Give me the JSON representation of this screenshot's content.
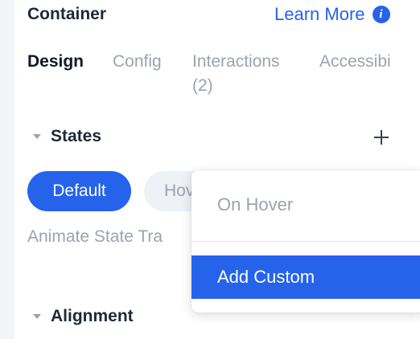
{
  "header": {
    "title": "Container",
    "learn_more": "Learn More"
  },
  "tabs": [
    {
      "label": "Design",
      "active": true
    },
    {
      "label": "Config"
    },
    {
      "label": "Interactions",
      "count": "(2)"
    },
    {
      "label": "Accessibi"
    }
  ],
  "states": {
    "title": "States",
    "pills": [
      "Default",
      "Hov"
    ],
    "animate_label": "Animate State Tra"
  },
  "dropdown": {
    "items": [
      "On Hover",
      "Add Custom"
    ]
  },
  "alignment": {
    "title": "Alignment"
  },
  "colors": {
    "accent": "#2563eb",
    "muted": "#9ca3af",
    "text": "#1f2937"
  },
  "icons": [
    "info-icon",
    "chevron-down-icon",
    "plus-icon"
  ]
}
